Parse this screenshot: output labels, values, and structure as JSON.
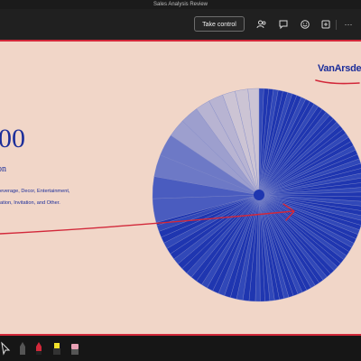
{
  "window": {
    "title": "Sales Analysis Review"
  },
  "toolbar": {
    "take_control_label": "Take control",
    "icons": [
      "people-icon",
      "chat-icon",
      "reactions-icon",
      "apps-icon",
      "more-icon"
    ],
    "more_label": "···"
  },
  "slide": {
    "headline_fragment": "00",
    "subheading_fragment": "on",
    "description_line1": "everage, Decor, Entertainment,",
    "description_line2": "ation, Invitation, and Other.",
    "brand_logo": "VanArsde",
    "colors": {
      "background": "#f1d6c8",
      "primary": "#1c2e9a",
      "annotation_ink": "#d2283a"
    }
  },
  "pie": {
    "description": "radial sliced pie",
    "slices_large_share": 0.75,
    "colors": [
      "#1f36b0",
      "#3148b8",
      "#4a5cbf",
      "#6d79c6",
      "#9d9fce",
      "#b8b4d2",
      "#ccc4d4"
    ]
  },
  "annotation_tools": [
    "pointer-tool",
    "pen-red",
    "pen-black",
    "highlighter-yellow",
    "eraser-tool"
  ]
}
